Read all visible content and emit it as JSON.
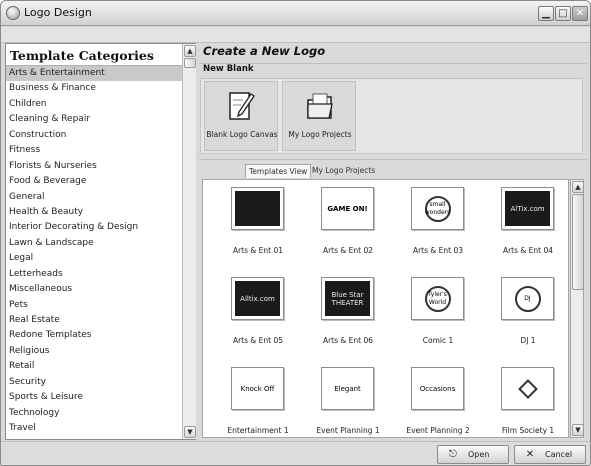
{
  "window": {
    "title": "Logo Design"
  },
  "sidebar": {
    "header": "Template Categories",
    "items": [
      "Arts & Entertainment",
      "Business & Finance",
      "Children",
      "Cleaning & Repair",
      "Construction",
      "Fitness",
      "Florists & Nurseries",
      "Food & Beverage",
      "General",
      "Health & Beauty",
      "Interior Decorating & Design",
      "Lawn & Landscape",
      "Legal",
      "Letterheads",
      "Miscellaneous",
      "Pets",
      "Real Estate",
      "Redone Templates",
      "Religious",
      "Retail",
      "Security",
      "Sports & Leisure",
      "Technology",
      "Travel"
    ],
    "selected_index": 0
  },
  "main": {
    "heading": "Create a New Logo",
    "new_blank_label": "New Blank",
    "tiles": [
      {
        "label": "Blank Logo Canvas",
        "icon": "pencil-canvas-icon"
      },
      {
        "label": "My Logo Projects",
        "icon": "folder-icon"
      }
    ],
    "tabs": [
      "Templates View",
      "My Logo Projects"
    ],
    "active_tab": 0,
    "templates": [
      {
        "label": "Arts & Ent 01",
        "logo_text": ""
      },
      {
        "label": "Arts & Ent 02",
        "logo_text": "GAME ON!"
      },
      {
        "label": "Arts & Ent 03",
        "logo_text": "small wonders"
      },
      {
        "label": "Arts & Ent 04",
        "logo_text": "AlTix.com"
      },
      {
        "label": "Arts & Ent 05",
        "logo_text": "Alltix.com"
      },
      {
        "label": "Arts & Ent 06",
        "logo_text": "Blue Star THEATER"
      },
      {
        "label": "Comic 1",
        "logo_text": "Tyler's World"
      },
      {
        "label": "DJ 1",
        "logo_text": "DJ"
      },
      {
        "label": "Entertainment 1",
        "logo_text": "Knock Off"
      },
      {
        "label": "Event Planning 1",
        "logo_text": "Elegant"
      },
      {
        "label": "Event Planning 2",
        "logo_text": "Occasions"
      },
      {
        "label": "Film Society 1",
        "logo_text": ""
      }
    ]
  },
  "footer": {
    "open_label": "Open",
    "cancel_label": "Cancel"
  },
  "colors": {
    "selection": "#c9c9c9",
    "window_bg": "#d9d9d9"
  }
}
